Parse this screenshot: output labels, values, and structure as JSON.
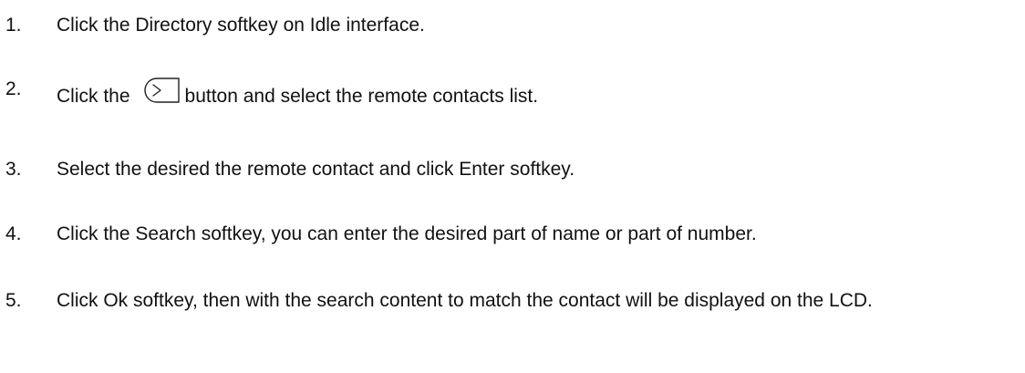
{
  "steps": [
    {
      "number": "1.",
      "text": "Click the Directory softkey on Idle interface."
    },
    {
      "number": "2.",
      "text_before": "Click the",
      "text_after": "button and select the remote contacts list.",
      "icon": "next-arrow-button-icon"
    },
    {
      "number": "3.",
      "text": "Select the desired the remote contact and click Enter softkey."
    },
    {
      "number": "4.",
      "text": "Click the Search softkey, you can enter the desired part of name or part of number."
    },
    {
      "number": "5.",
      "text": "Click Ok softkey, then with the search content to match the contact will be displayed on the LCD."
    }
  ]
}
